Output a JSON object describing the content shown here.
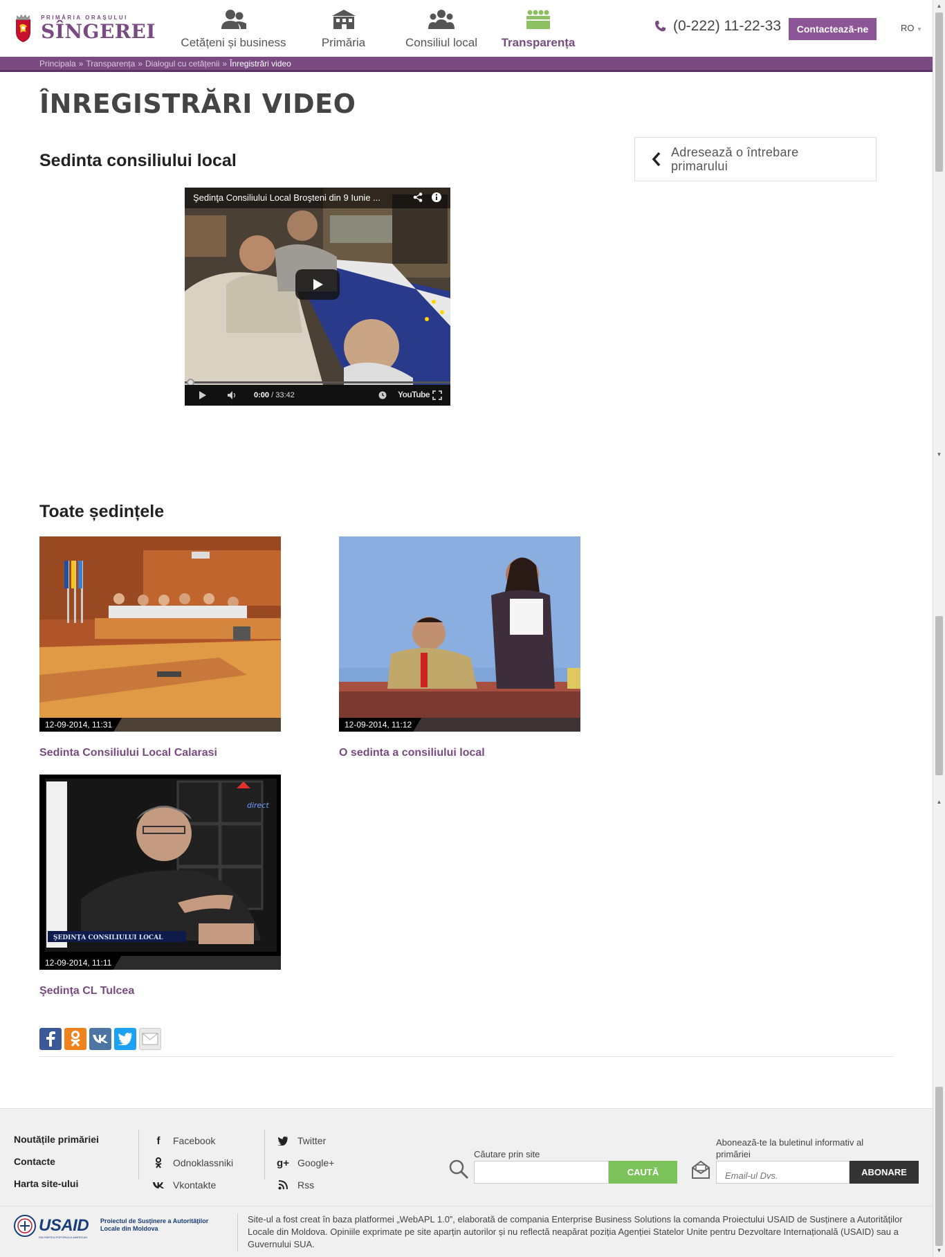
{
  "header": {
    "logo_sub": "Primăria orașului",
    "logo_name": "SÎNGEREI",
    "nav": [
      {
        "label": "Cetățeni și business",
        "icon": "people-icon"
      },
      {
        "label": "Primăria",
        "icon": "building-icon"
      },
      {
        "label": "Consiliul local",
        "icon": "council-icon"
      },
      {
        "label": "Transparența",
        "icon": "meeting-icon"
      }
    ],
    "phone": "(0-222) 11-22-33",
    "contact_label": "Contactează-ne",
    "lang": "RO"
  },
  "breadcrumb": [
    "Principala",
    "Transparența",
    "Dialogul cu cetățenii",
    "Înregistrări video"
  ],
  "page_title": "ÎNREGISTRĂRI VIDEO",
  "sidebar": {
    "ask_line1": "Adresează o întrebare",
    "ask_line2": "primarului"
  },
  "featured": {
    "section_title": "Sedinta consiliului local",
    "player": {
      "title": "Şedinţa Consiliului Local Broşteni din 9 Iunie ...",
      "time_current": "0:00",
      "time_total": "/ 33:42",
      "brand": "YouTube"
    }
  },
  "all_sessions": {
    "section_title": "Toate ședințele",
    "items": [
      {
        "date": "12-09-2014, 11:31",
        "title": "Sedinta Consiliului Local Calarasi"
      },
      {
        "date": "12-09-2014, 11:12",
        "title": "O sedinta a consiliului local"
      },
      {
        "date": "12-09-2014, 11:11",
        "title": "Şedinţa CL Tulcea",
        "overlay": "ŞEDINŢA CONSILIULUI LOCAL",
        "channel": "direct"
      }
    ]
  },
  "share": [
    {
      "name": "facebook",
      "color": "#3b5998"
    },
    {
      "name": "odnoklassniki",
      "color": "#f0821e"
    },
    {
      "name": "vkontakte",
      "color": "#4c75a3"
    },
    {
      "name": "twitter",
      "color": "#1da1f2"
    },
    {
      "name": "email",
      "color": "#e8e8e8"
    }
  ],
  "footer": {
    "links": [
      "Noutățile primăriei",
      "Contacte",
      "Harta site-ului"
    ],
    "social_col1": [
      "Facebook",
      "Odnoklassniki",
      "Vkontakte"
    ],
    "social_col2": [
      "Twitter",
      "Google+",
      "Rss"
    ],
    "search_label": "Căutare prin site",
    "search_button": "CAUTĂ",
    "subscribe_label": "Abonează-te la buletinul informativ al primăriei",
    "subscribe_placeholder": "Email-ul Dvs.",
    "subscribe_button": "ABONARE",
    "usaid_word": "USAID",
    "usaid_sub": "DIN PARTEA POPORULUI AMERICAN",
    "usaid_project": "Proiectul de Susţinere a Autorităţilor Locale din Moldova",
    "disclaimer": "Site-ul a fost creat în baza platformei „WebAPL 1.0”, elaborată de compania Enterprise Business Solutions la comanda Proiectului USAID de Susținere a Autorităților Locale din Moldova. Opiniile exprimate pe site aparțin autorilor și nu reflectă neapărat poziția Agenției Statelor Unite pentru Dezvoltare Internațională (USAID) sau a Guvernului SUA."
  }
}
